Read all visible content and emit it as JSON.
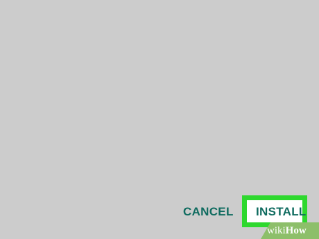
{
  "dialog": {
    "background_color": "#cccccc",
    "actions": {
      "cancel_label": "CANCEL",
      "install_label": "INSTALL",
      "text_color": "#0f6b5f",
      "highlight_color": "#2ed82e"
    }
  },
  "watermark": {
    "brand_light": "wiki",
    "brand_bold": "How",
    "background_color": "#8dbf6a"
  }
}
